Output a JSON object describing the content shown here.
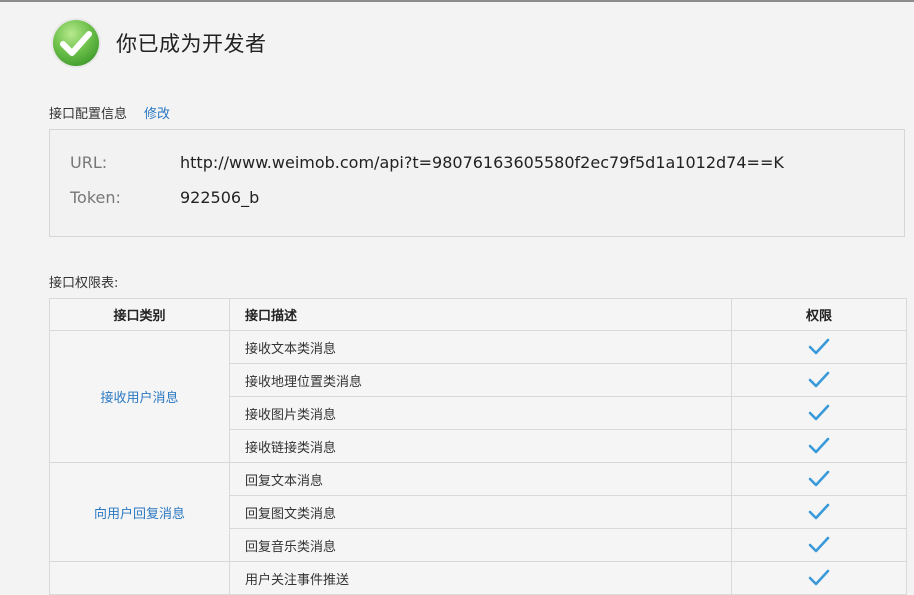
{
  "header": {
    "title": "你已成为开发者"
  },
  "config": {
    "section_title": "接口配置信息",
    "edit_label": "修改",
    "url_label": "URL:",
    "url_value": "http://www.weimob.com/api?t=98076163605580f2ec79f5d1a1012d74==K",
    "token_label": "Token:",
    "token_value": "922506_b"
  },
  "permissions": {
    "section_title": "接口权限表:",
    "headers": {
      "category": "接口类别",
      "description": "接口描述",
      "permission": "权限"
    },
    "groups": [
      {
        "category": "接收用户消息",
        "items": [
          "接收文本类消息",
          "接收地理位置类消息",
          "接收图片类消息",
          "接收链接类消息"
        ]
      },
      {
        "category": "向用户回复消息",
        "items": [
          "回复文本消息",
          "回复图文类消息",
          "回复音乐类消息"
        ]
      },
      {
        "category": "",
        "items": [
          "用户关注事件推送"
        ]
      }
    ]
  },
  "colors": {
    "accent": "#2a78c2",
    "check": "#3a9ad9",
    "success_green": "#6cc04a"
  },
  "icons": {
    "success": "check-circle-icon",
    "permission": "check-icon"
  }
}
